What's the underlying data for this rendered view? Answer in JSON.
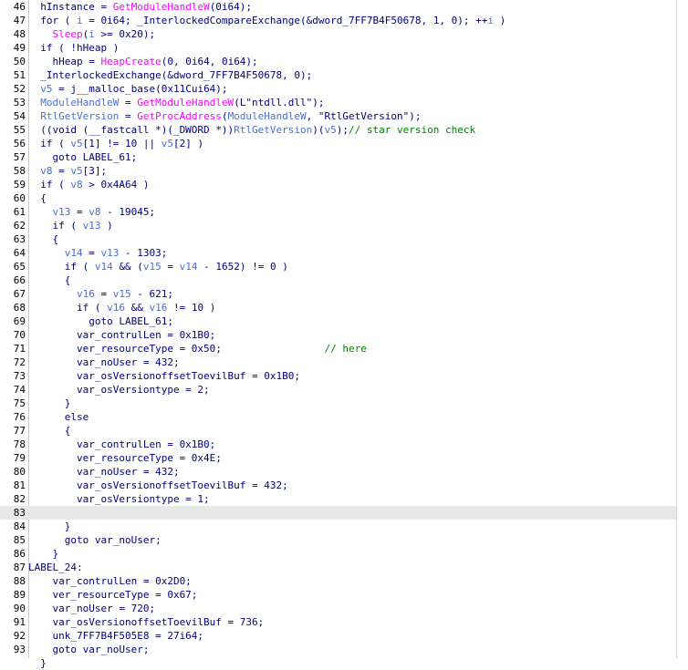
{
  "editor": {
    "highlighted_line": "83",
    "lines": [
      {
        "n": "46",
        "seg": [
          [
            "tx",
            "  hInstance = "
          ],
          [
            "fn",
            "GetModuleHandleW"
          ],
          [
            "tx",
            "(0i64);"
          ]
        ]
      },
      {
        "n": "47",
        "seg": [
          [
            "tx",
            "  for ( "
          ],
          [
            "var",
            "i"
          ],
          [
            "tx",
            " = 0i64; _InterlockedCompareExchange(&dword_7FF7B4F50678, 1, 0); ++"
          ],
          [
            "var",
            "i"
          ],
          [
            "tx",
            " )"
          ]
        ]
      },
      {
        "n": "48",
        "seg": [
          [
            "tx",
            "    "
          ],
          [
            "fn",
            "Sleep"
          ],
          [
            "tx",
            "("
          ],
          [
            "var",
            "i"
          ],
          [
            "tx",
            " >= 0x20);"
          ]
        ]
      },
      {
        "n": "49",
        "seg": [
          [
            "tx",
            "  if ( !hHeap )"
          ]
        ]
      },
      {
        "n": "50",
        "seg": [
          [
            "tx",
            "    hHeap = "
          ],
          [
            "fn",
            "HeapCreate"
          ],
          [
            "tx",
            "(0, 0i64, 0i64);"
          ]
        ]
      },
      {
        "n": "51",
        "seg": [
          [
            "tx",
            "  _InterlockedExchange(&dword_7FF7B4F50678, 0);"
          ]
        ]
      },
      {
        "n": "52",
        "seg": [
          [
            "tx",
            "  "
          ],
          [
            "var",
            "v5"
          ],
          [
            "tx",
            " = j__malloc_base(0x11Cui64);"
          ]
        ]
      },
      {
        "n": "53",
        "seg": [
          [
            "tx",
            "  "
          ],
          [
            "var",
            "ModuleHandleW"
          ],
          [
            "tx",
            " = "
          ],
          [
            "fn",
            "GetModuleHandleW"
          ],
          [
            "tx",
            "(L\"ntdll.dll\");"
          ]
        ]
      },
      {
        "n": "54",
        "seg": [
          [
            "tx",
            "  "
          ],
          [
            "var",
            "RtlGetVersion"
          ],
          [
            "tx",
            " = "
          ],
          [
            "fn",
            "GetProcAddress"
          ],
          [
            "tx",
            "("
          ],
          [
            "var",
            "ModuleHandleW"
          ],
          [
            "tx",
            ", \"RtlGetVersion\");"
          ]
        ]
      },
      {
        "n": "55",
        "seg": [
          [
            "tx",
            "  ((void (__fastcall *)(_DWORD *))"
          ],
          [
            "var",
            "RtlGetVersion"
          ],
          [
            "tx",
            ")("
          ],
          [
            "var",
            "v5"
          ],
          [
            "tx",
            ");"
          ],
          [
            "cm",
            "// star version check"
          ]
        ]
      },
      {
        "n": "56",
        "seg": [
          [
            "tx",
            "  if ( "
          ],
          [
            "var",
            "v5"
          ],
          [
            "tx",
            "[1] != 10 || "
          ],
          [
            "var",
            "v5"
          ],
          [
            "tx",
            "[2] )"
          ]
        ]
      },
      {
        "n": "57",
        "seg": [
          [
            "tx",
            "    goto LABEL_61;"
          ]
        ]
      },
      {
        "n": "58",
        "seg": [
          [
            "tx",
            "  "
          ],
          [
            "var",
            "v8"
          ],
          [
            "tx",
            " = "
          ],
          [
            "var",
            "v5"
          ],
          [
            "tx",
            "[3];"
          ]
        ]
      },
      {
        "n": "59",
        "seg": [
          [
            "tx",
            "  if ( "
          ],
          [
            "var",
            "v8"
          ],
          [
            "tx",
            " > 0x4A64 )"
          ]
        ]
      },
      {
        "n": "60",
        "seg": [
          [
            "tx",
            "  {"
          ]
        ]
      },
      {
        "n": "61",
        "seg": [
          [
            "tx",
            "    "
          ],
          [
            "var",
            "v13"
          ],
          [
            "tx",
            " = "
          ],
          [
            "var",
            "v8"
          ],
          [
            "tx",
            " - 19045;"
          ]
        ]
      },
      {
        "n": "62",
        "seg": [
          [
            "tx",
            "    if ( "
          ],
          [
            "var",
            "v13"
          ],
          [
            "tx",
            " )"
          ]
        ]
      },
      {
        "n": "63",
        "seg": [
          [
            "tx",
            "    {"
          ]
        ]
      },
      {
        "n": "64",
        "seg": [
          [
            "tx",
            "      "
          ],
          [
            "var",
            "v14"
          ],
          [
            "tx",
            " = "
          ],
          [
            "var",
            "v13"
          ],
          [
            "tx",
            " - 1303;"
          ]
        ]
      },
      {
        "n": "65",
        "seg": [
          [
            "tx",
            "      if ( "
          ],
          [
            "var",
            "v14"
          ],
          [
            "tx",
            " && ("
          ],
          [
            "var",
            "v15"
          ],
          [
            "tx",
            " = "
          ],
          [
            "var",
            "v14"
          ],
          [
            "tx",
            " - 1652) != 0 )"
          ]
        ]
      },
      {
        "n": "66",
        "seg": [
          [
            "tx",
            "      {"
          ]
        ]
      },
      {
        "n": "67",
        "seg": [
          [
            "tx",
            "        "
          ],
          [
            "var",
            "v16"
          ],
          [
            "tx",
            " = "
          ],
          [
            "var",
            "v15"
          ],
          [
            "tx",
            " - 621;"
          ]
        ]
      },
      {
        "n": "68",
        "seg": [
          [
            "tx",
            "        if ( "
          ],
          [
            "var",
            "v16"
          ],
          [
            "tx",
            " && "
          ],
          [
            "var",
            "v16"
          ],
          [
            "tx",
            " != 10 )"
          ]
        ]
      },
      {
        "n": "69",
        "seg": [
          [
            "tx",
            "          goto LABEL_61;"
          ]
        ]
      },
      {
        "n": "70",
        "seg": [
          [
            "tx",
            "        var_contrulLen = 0x1B0;"
          ]
        ]
      },
      {
        "n": "71",
        "seg": [
          [
            "tx",
            "        ver_resourceType = 0x50;                 "
          ],
          [
            "cm",
            "// here"
          ]
        ]
      },
      {
        "n": "72",
        "seg": [
          [
            "tx",
            "        var_noUser = 432;"
          ]
        ]
      },
      {
        "n": "73",
        "seg": [
          [
            "tx",
            "        var_osVersionoffsetToevilBuf = 0x1B0;"
          ]
        ]
      },
      {
        "n": "74",
        "seg": [
          [
            "tx",
            "        var_osVersiontype = 2;"
          ]
        ]
      },
      {
        "n": "75",
        "seg": [
          [
            "tx",
            "      }"
          ]
        ]
      },
      {
        "n": "76",
        "seg": [
          [
            "tx",
            "      else"
          ]
        ]
      },
      {
        "n": "77",
        "seg": [
          [
            "tx",
            "      {"
          ]
        ]
      },
      {
        "n": "78",
        "seg": [
          [
            "tx",
            "        var_contrulLen = 0x1B0;"
          ]
        ]
      },
      {
        "n": "79",
        "seg": [
          [
            "tx",
            "        ver_resourceType = 0x4E;"
          ]
        ]
      },
      {
        "n": "80",
        "seg": [
          [
            "tx",
            "        var_noUser = 432;"
          ]
        ]
      },
      {
        "n": "81",
        "seg": [
          [
            "tx",
            "        var_osVersionoffsetToevilBuf = 432;"
          ]
        ]
      },
      {
        "n": "82",
        "seg": [
          [
            "tx",
            "        var_osVersiontype = 1;"
          ]
        ]
      },
      {
        "n": "83",
        "seg": [
          [
            "tx",
            ""
          ]
        ]
      },
      {
        "n": "84",
        "seg": [
          [
            "tx",
            "      }"
          ]
        ]
      },
      {
        "n": "85",
        "seg": [
          [
            "tx",
            "      goto var_noUser;"
          ]
        ]
      },
      {
        "n": "86",
        "seg": [
          [
            "tx",
            "    }"
          ]
        ]
      },
      {
        "n": "87",
        "seg": [
          [
            "tx",
            "LABEL_24:"
          ]
        ]
      },
      {
        "n": "88",
        "seg": [
          [
            "tx",
            "    var_contrulLen = 0x2D0;"
          ]
        ]
      },
      {
        "n": "89",
        "seg": [
          [
            "tx",
            "    ver_resourceType = 0x67;"
          ]
        ]
      },
      {
        "n": "90",
        "seg": [
          [
            "tx",
            "    var_noUser = 720;"
          ]
        ]
      },
      {
        "n": "91",
        "seg": [
          [
            "tx",
            "    var_osVersionoffsetToevilBuf = 736;"
          ]
        ]
      },
      {
        "n": "92",
        "seg": [
          [
            "tx",
            "    unk_7FF7B4F505E8 = 27i64;"
          ]
        ]
      },
      {
        "n": "93",
        "seg": [
          [
            "tx",
            "    goto var_noUser;"
          ]
        ]
      },
      {
        "n": "",
        "seg": [
          [
            "tx",
            "  }"
          ]
        ]
      }
    ]
  }
}
